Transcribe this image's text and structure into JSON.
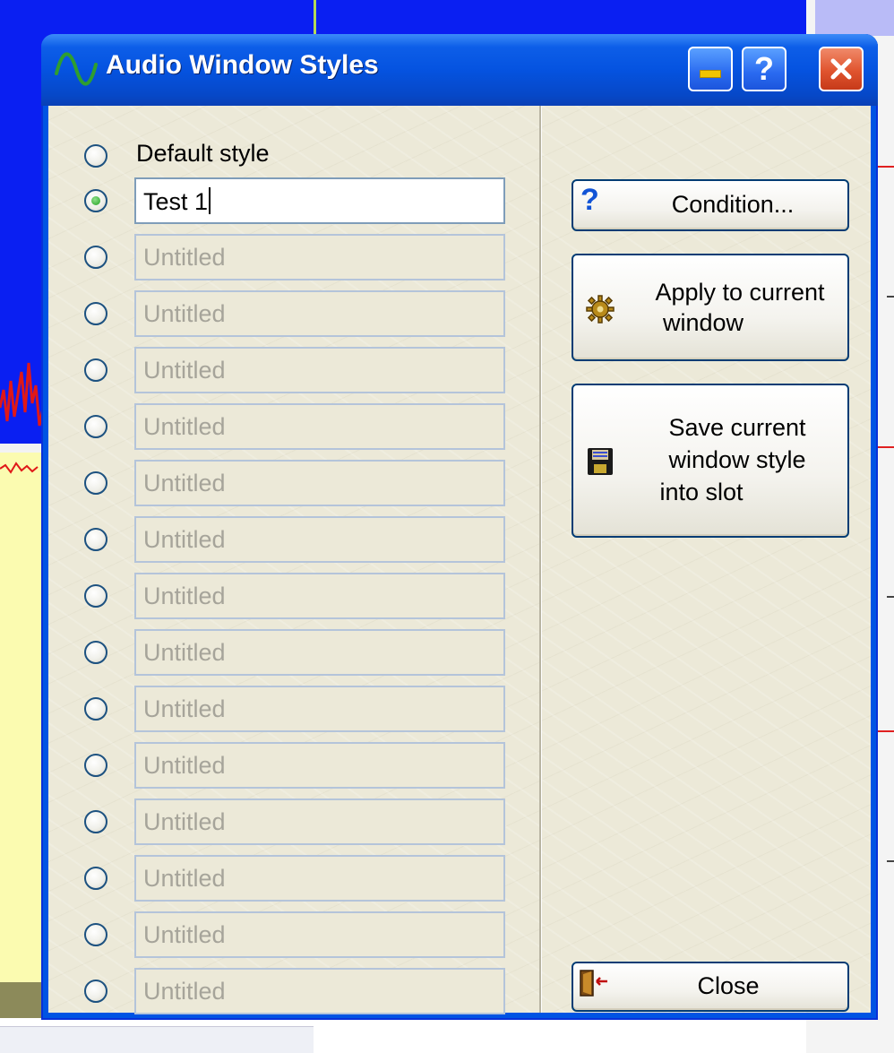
{
  "window": {
    "title": "Audio Window Styles",
    "controls": {
      "help_label": "?"
    }
  },
  "slots": {
    "default_label": "Default style",
    "selected_index": 1,
    "items": [
      {
        "value": "Test 1",
        "active": true
      },
      {
        "placeholder": "Untitled"
      },
      {
        "placeholder": "Untitled"
      },
      {
        "placeholder": "Untitled"
      },
      {
        "placeholder": "Untitled"
      },
      {
        "placeholder": "Untitled"
      },
      {
        "placeholder": "Untitled"
      },
      {
        "placeholder": "Untitled"
      },
      {
        "placeholder": "Untitled"
      },
      {
        "placeholder": "Untitled"
      },
      {
        "placeholder": "Untitled"
      },
      {
        "placeholder": "Untitled"
      },
      {
        "placeholder": "Untitled"
      },
      {
        "placeholder": "Untitled"
      },
      {
        "placeholder": "Untitled"
      }
    ]
  },
  "buttons": {
    "condition": "Condition...",
    "apply_line1": "Apply to current",
    "apply_line2": "window",
    "save_line1": "Save current",
    "save_line2": "window style",
    "save_line3": "into slot",
    "close": "Close"
  },
  "icons": {
    "title": "sine-wave-icon",
    "condition": "question-mark-icon",
    "apply": "gear-icon",
    "save": "floppy-disk-icon",
    "close": "exit-door-icon"
  },
  "colors": {
    "titlebar": "#0553e0",
    "client": "#ece9d8",
    "button_border": "#003c74",
    "placeholder_text": "#a6a49a",
    "close_button": "#e0542e"
  }
}
